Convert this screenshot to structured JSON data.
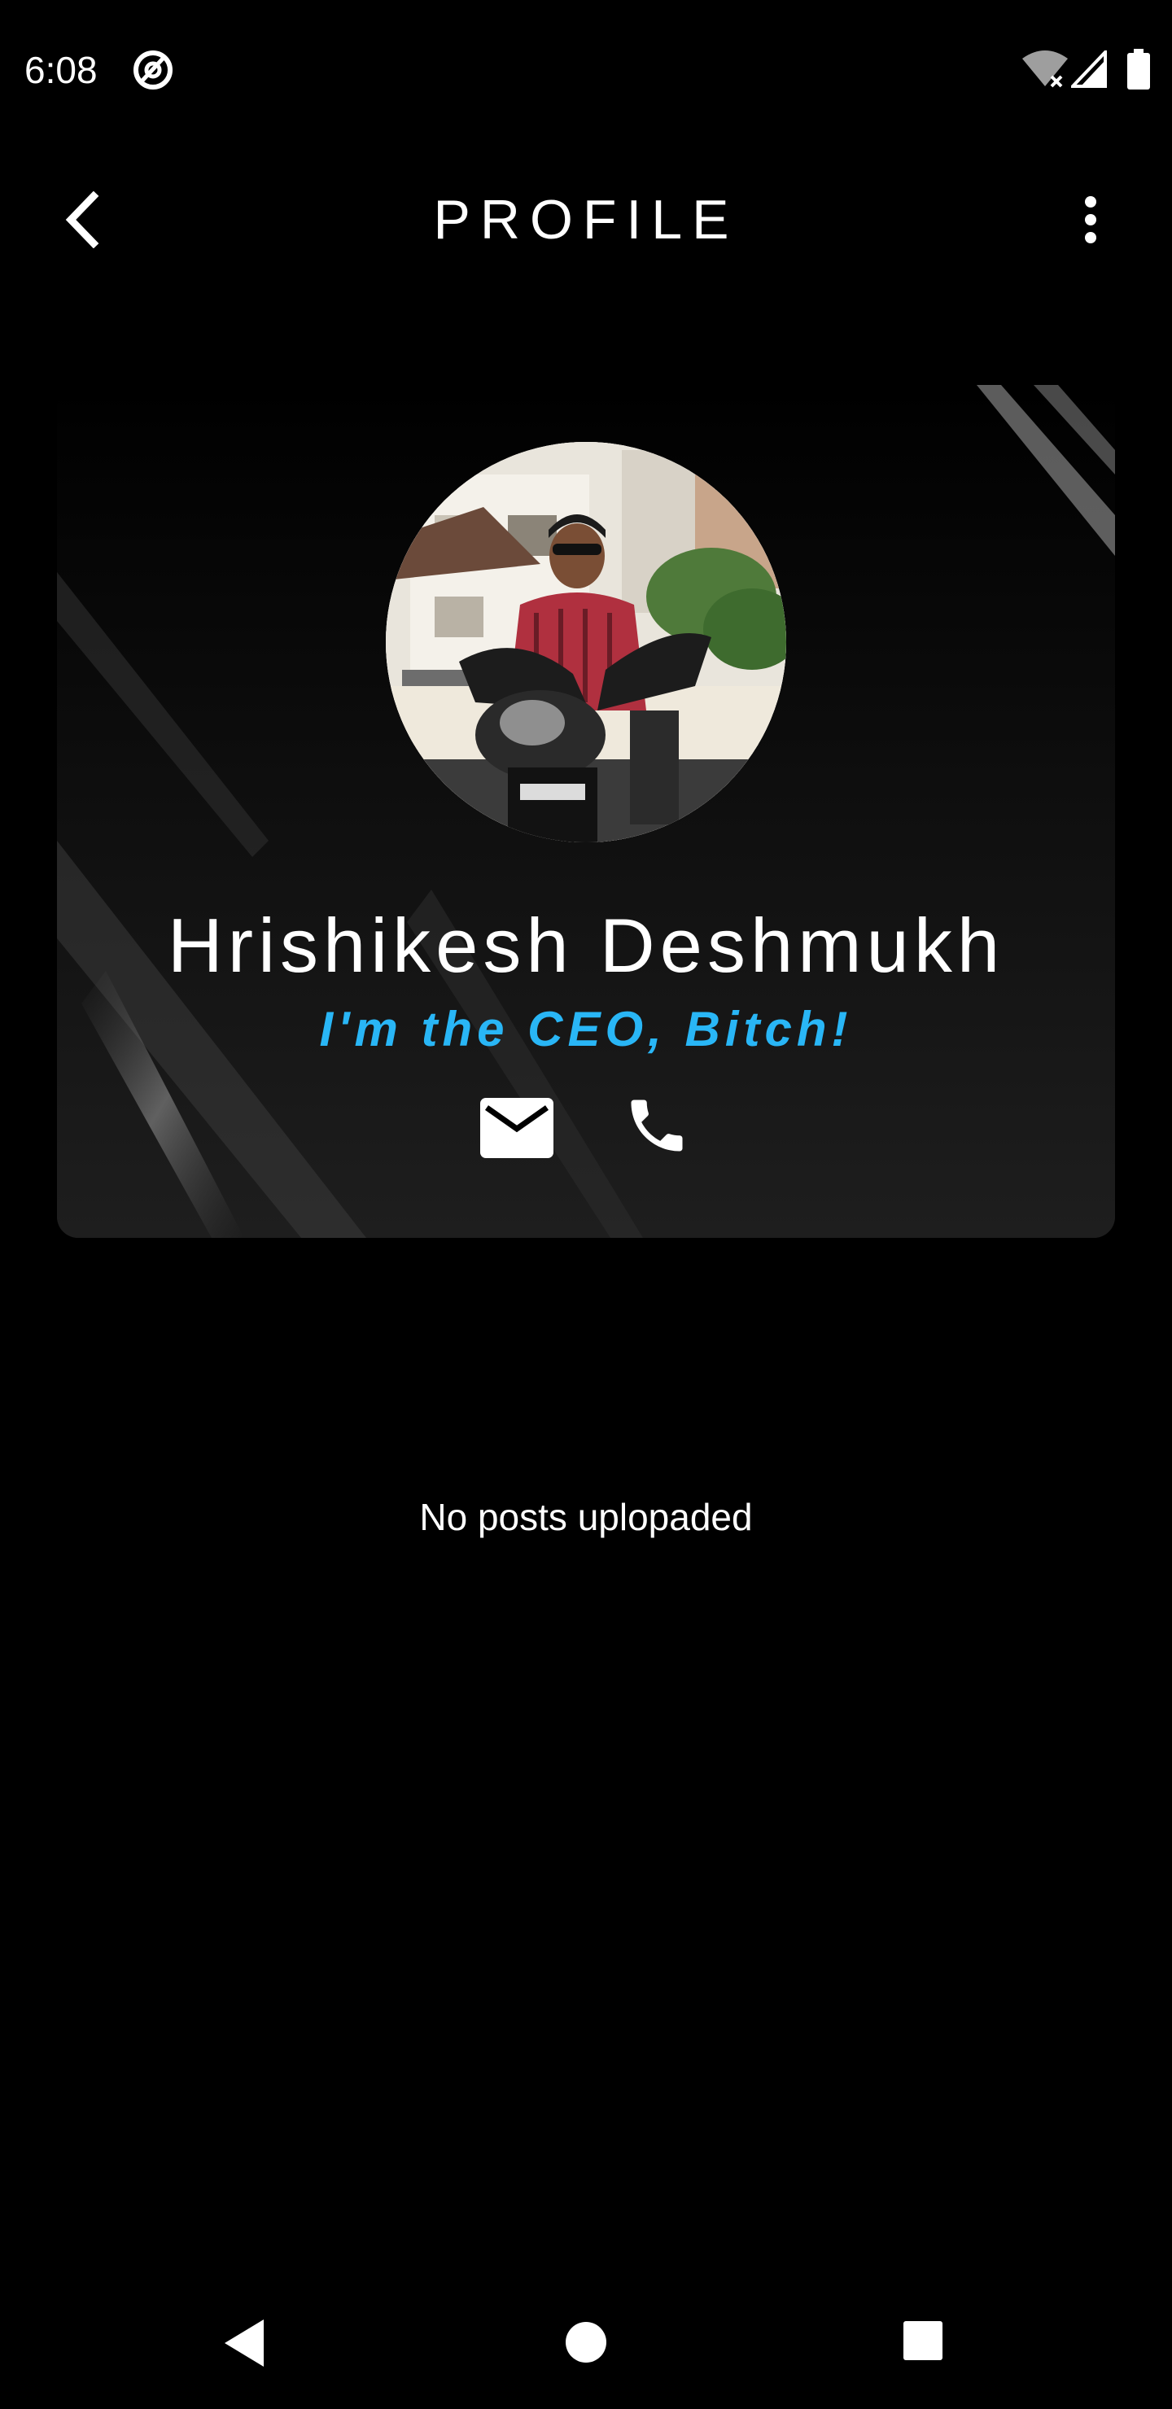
{
  "status_bar": {
    "time": "6:08",
    "app_icon": "at-sign-circle-icon",
    "wifi_icon": "wifi-off-icon",
    "signal_icon": "cell-signal-icon",
    "battery_icon": "battery-full-icon"
  },
  "app_bar": {
    "title": "PROFILE",
    "back_icon": "chevron-left-icon",
    "menu_icon": "more-vert-icon"
  },
  "profile": {
    "name": "Hrishikesh Deshmukh",
    "tagline": "I'm the CEO, Bitch!",
    "tagline_color": "#29b6f6",
    "avatar_icon": "profile-photo",
    "email_icon": "email-icon",
    "phone_icon": "phone-icon"
  },
  "posts": {
    "empty_message": "No posts uplopaded"
  },
  "nav_bar": {
    "back_icon": "nav-back-icon",
    "home_icon": "nav-home-icon",
    "recents_icon": "nav-recents-icon"
  },
  "colors": {
    "background": "#000000",
    "text": "#ffffff",
    "accent": "#29b6f6"
  }
}
